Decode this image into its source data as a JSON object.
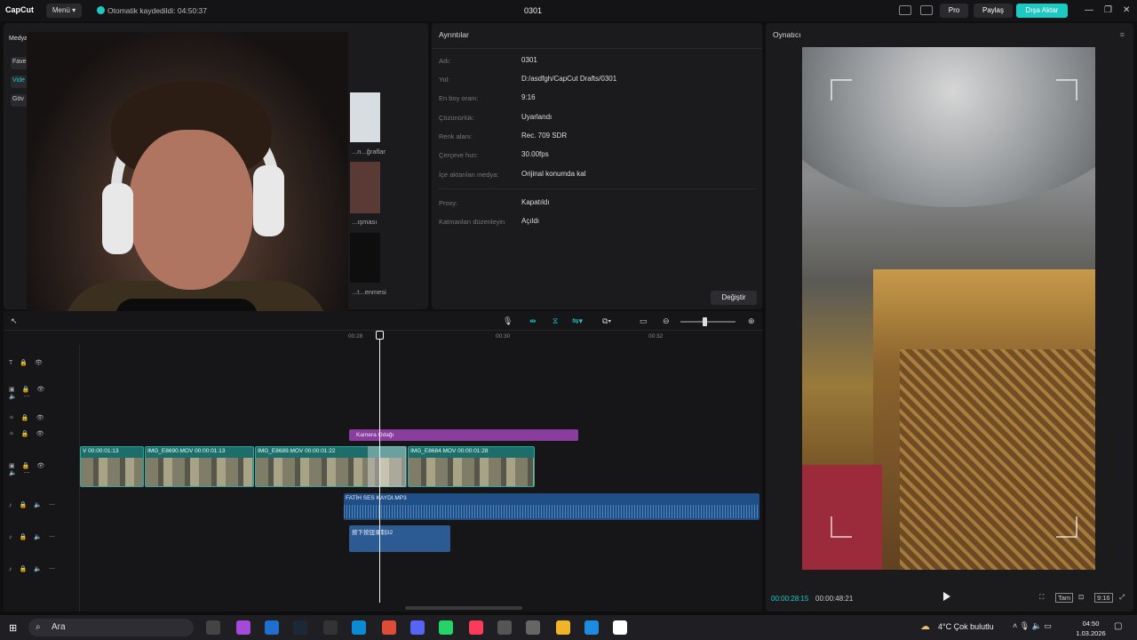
{
  "titlebar": {
    "logo": "CapCut",
    "menu_label": "Menü",
    "autosave_text": "Otomatik kaydedildi: 04:50:37",
    "project_name": "0301",
    "pro_label": "Pro",
    "share_label": "Paylaş",
    "export_label": "Dışa Aktar",
    "accent_color": "#1ec9c1"
  },
  "media": {
    "tab_label": "Medya",
    "side_items": [
      "Fave",
      "Vide",
      "Göv"
    ],
    "thumbs": [
      "...n...ğraflar",
      "...ışması",
      "...t...enmesi"
    ]
  },
  "details": {
    "title": "Ayrıntılar",
    "rows": [
      {
        "label": "Adı:",
        "value": "0301"
      },
      {
        "label": "Yol:",
        "value": "D:/asdfgh/CapCut Drafts/0301"
      },
      {
        "label": "En boy oranı:",
        "value": "9:16"
      },
      {
        "label": "Çözünürlük:",
        "value": "Uyarlandı"
      },
      {
        "label": "Renk alanı:",
        "value": "Rec. 709 SDR"
      },
      {
        "label": "Çerçeve hızı:",
        "value": "30.00fps"
      },
      {
        "label": "İçe aktarılan medya:",
        "value": "Orijinal konumda kal"
      }
    ],
    "rows2": [
      {
        "label": "Proxy:",
        "value": "Kapatıldı"
      },
      {
        "label": "Katmanları düzenleyin",
        "value": "Açıldı"
      }
    ],
    "change_label": "Değiştir"
  },
  "player": {
    "title": "Oynatıcı",
    "current_time": "00:00:28:15",
    "total_time": "00:00:48:21",
    "ctl_labels": [
      "Tam",
      "9:16"
    ]
  },
  "timeline": {
    "ruler_ticks": [
      "00:28",
      "00:30",
      "00:32"
    ],
    "clips": [
      {
        "name": "V",
        "time": "00:00:01:13"
      },
      {
        "name": "IMG_E8690.MOV",
        "time": "00:00:01:13"
      },
      {
        "name": "IMG_E8689.MOV",
        "time": "00:00:01:22"
      },
      {
        "name": "IMG_E8684.MOV",
        "time": "00:00:01:28"
      }
    ],
    "fx_label": "Kamera Odağı",
    "audio1_label": "FATİH SES KAYDI.MP3",
    "audio2_label": "按下按钮录制32"
  },
  "taskbar": {
    "search_placeholder": "Ara",
    "weather": "4°C  Çok bulutlu",
    "time": "04:50",
    "date": "1.03.2026"
  }
}
